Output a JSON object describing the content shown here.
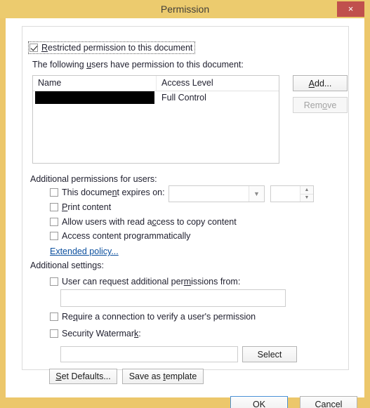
{
  "window": {
    "title": "Permission",
    "close_label": "×",
    "frame_color": "#ecc76b",
    "close_color": "#c0504d"
  },
  "restricted": {
    "label": "Restricted permission to this document",
    "checked": true
  },
  "users": {
    "caption": "The following users have permission to this document:",
    "columns": [
      "Name",
      "Access Level"
    ],
    "rows": [
      {
        "name": "",
        "name_redacted": true,
        "access_level": "Full Control"
      }
    ],
    "add_label": "Add...",
    "remove_label": "Remove",
    "remove_disabled": true
  },
  "additional_permissions": {
    "caption": "Additional permissions for users:",
    "expires": {
      "label": "This document expires on:",
      "checked": false,
      "date_value": "",
      "date_placeholder": "",
      "spin_value": ""
    },
    "checkboxes": [
      {
        "label": "Print content",
        "checked": false
      },
      {
        "label": "Allow users with read access to copy content",
        "checked": false
      },
      {
        "label": "Access content programmatically",
        "checked": false
      }
    ],
    "extended_policy_link": "Extended policy..."
  },
  "additional_settings": {
    "caption": "Additional settings:",
    "request_from": {
      "label": "User can request additional permissions from:",
      "checked": false,
      "value": "",
      "placeholder": ""
    },
    "require_connection": {
      "label": "Require a connection to verify a user's permission",
      "checked": false
    },
    "watermark": {
      "label": "Security Watermark:",
      "checked": false,
      "value": "",
      "placeholder": "",
      "select_label": "Select"
    }
  },
  "footer": {
    "set_defaults_label": "Set Defaults...",
    "save_template_label": "Save as template",
    "ok_label": "OK",
    "cancel_label": "Cancel"
  }
}
